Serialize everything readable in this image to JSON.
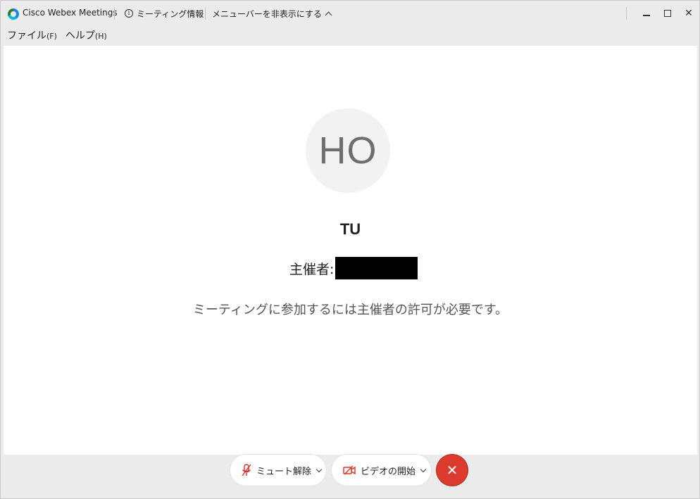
{
  "titlebar": {
    "app_title": "Cisco Webex Meetings",
    "meeting_info_label": "ミーティング情報",
    "hide_menu_label": "メニューバーを非表示にする"
  },
  "menubar": {
    "items": [
      {
        "label": "ファイル",
        "accel": "(F)"
      },
      {
        "label": "ヘルプ",
        "accel": "(H)"
      }
    ]
  },
  "content": {
    "avatar_initials": "HO",
    "participant_name": "TU",
    "host_label": "主催者:",
    "wait_message": "ミーティングに参加するには主催者の許可が必要です。"
  },
  "controls": {
    "unmute_label": "ミュート解除",
    "start_video_label": "ビデオの開始"
  },
  "colors": {
    "leave_button": "#db3a2c",
    "icon_accent": "#d93025"
  }
}
